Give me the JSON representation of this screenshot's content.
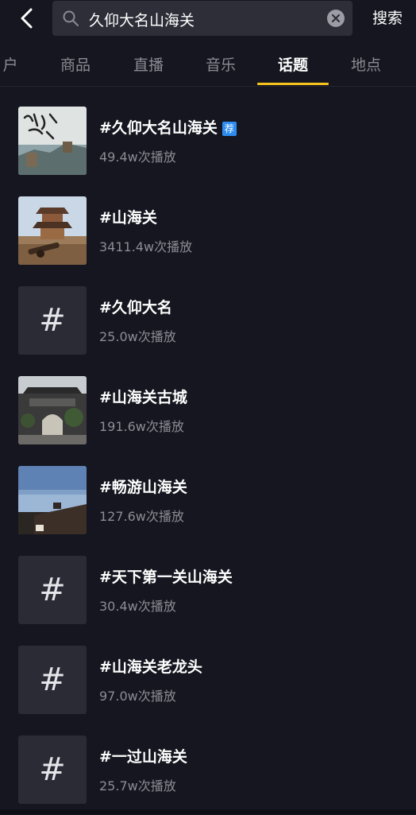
{
  "header": {
    "back_icon": "chevron-left-icon",
    "search_icon": "search-icon",
    "search_value": "久仰大名山海关",
    "clear_icon": "clear-icon",
    "search_button": "搜索"
  },
  "tabs": [
    {
      "label": "户"
    },
    {
      "label": "商品"
    },
    {
      "label": "直播"
    },
    {
      "label": "音乐"
    },
    {
      "label": "话题"
    },
    {
      "label": "地点"
    }
  ],
  "active_tab": "话题",
  "accent_color": "#f5c31d",
  "topics": [
    {
      "title": "#久仰大名山海关",
      "badge": "荐",
      "plays": "49.4w次播放",
      "thumb": "calligraphy-great-wall-image"
    },
    {
      "title": "#山海关",
      "plays": "3411.4w次播放",
      "thumb": "tower-cannon-image"
    },
    {
      "title": "#久仰大名",
      "plays": "25.0w次播放",
      "thumb": "#"
    },
    {
      "title": "#山海关古城",
      "plays": "191.6w次播放",
      "thumb": "ancient-gate-image"
    },
    {
      "title": "#畅游山海关",
      "plays": "127.6w次播放",
      "thumb": "seaside-dusk-image"
    },
    {
      "title": "#天下第一关山海关",
      "plays": "30.4w次播放",
      "thumb": "#"
    },
    {
      "title": "#山海关老龙头",
      "plays": "97.0w次播放",
      "thumb": "#"
    },
    {
      "title": "#一过山海关",
      "plays": "25.7w次播放",
      "thumb": "#"
    }
  ]
}
